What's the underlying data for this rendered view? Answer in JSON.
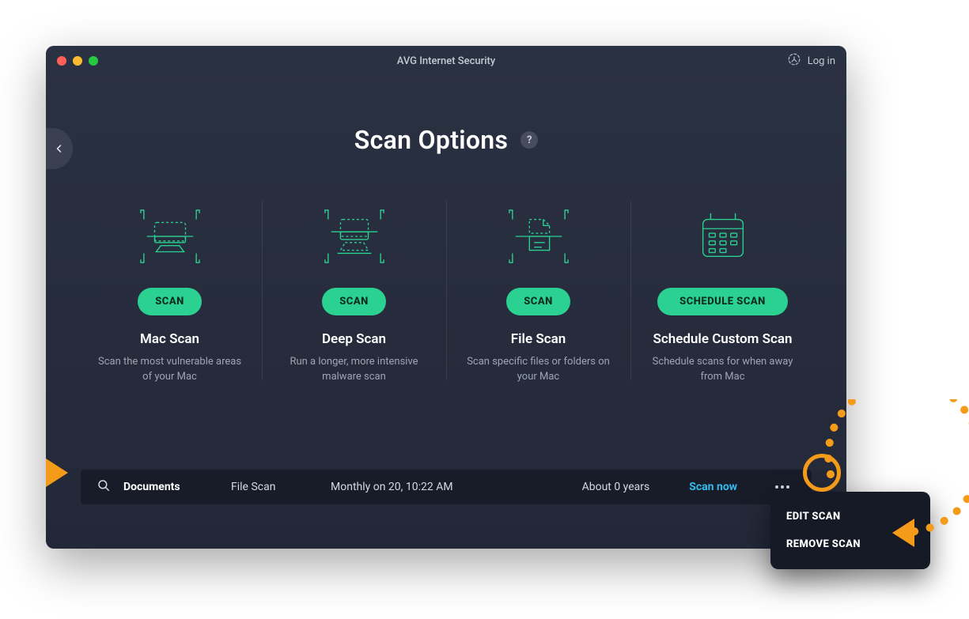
{
  "window": {
    "title": "AVG Internet Security",
    "login_label": "Log in"
  },
  "page": {
    "title": "Scan Options",
    "help_symbol": "?"
  },
  "options": [
    {
      "button": "SCAN",
      "title": "Mac Scan",
      "desc": "Scan the most vulnerable areas of your Mac"
    },
    {
      "button": "SCAN",
      "title": "Deep Scan",
      "desc": "Run a longer, more intensive malware scan"
    },
    {
      "button": "SCAN",
      "title": "File Scan",
      "desc": "Scan specific files or folders on your Mac"
    },
    {
      "button": "SCHEDULE SCAN",
      "title": "Schedule Custom Scan",
      "desc": "Schedule scans for when away from Mac"
    }
  ],
  "scheduled_scan": {
    "name": "Documents",
    "type": "File Scan",
    "schedule": "Monthly on 20, 10:22 AM",
    "age": "About 0 years",
    "scan_now_label": "Scan now"
  },
  "context_menu": {
    "edit": "EDIT SCAN",
    "remove": "REMOVE SCAN"
  },
  "annotation_color": "#f49b1a"
}
